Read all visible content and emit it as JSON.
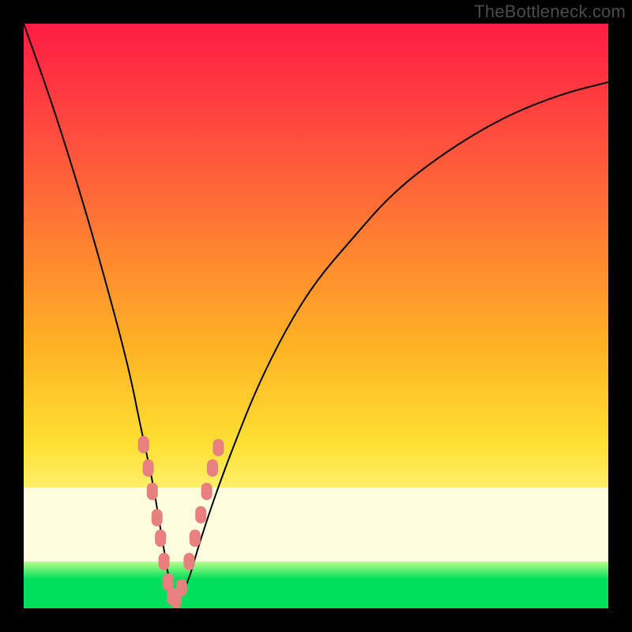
{
  "watermark": "TheBottleneck.com",
  "colors": {
    "frame": "#000000",
    "grad_top": "#ff1c44",
    "grad_mid": "#ffb224",
    "grad_yellow": "#fff06a",
    "grad_pale": "#ffffe0",
    "grad_green": "#00e05c",
    "curve": "#000000",
    "marker_fill": "#e98080",
    "marker_stroke": "#e98080"
  },
  "chart_data": {
    "type": "line",
    "title": "",
    "xlabel": "",
    "ylabel": "",
    "xlim": [
      0,
      100
    ],
    "ylim": [
      0,
      100
    ],
    "grid": false,
    "legend": false,
    "series": [
      {
        "name": "bottleneck-curve",
        "x": [
          0,
          5,
          10,
          14,
          18,
          20,
          22,
          23,
          24,
          25,
          26,
          28,
          30,
          33,
          36,
          40,
          45,
          50,
          56,
          63,
          72,
          82,
          92,
          100
        ],
        "y": [
          100,
          86,
          70,
          56,
          41,
          31,
          22,
          16,
          10,
          4,
          1,
          4,
          11,
          20,
          28,
          38,
          48,
          56,
          63,
          71,
          78,
          84,
          88,
          90
        ]
      }
    ],
    "markers": {
      "name": "highlight-points",
      "x": [
        20.5,
        21.3,
        22.0,
        22.8,
        23.4,
        24.0,
        24.7,
        25.4,
        26.1,
        27.0,
        28.3,
        29.3,
        30.3,
        31.3,
        32.3,
        33.3
      ],
      "y": [
        28.0,
        24.0,
        20.0,
        15.5,
        12.0,
        8.0,
        4.5,
        2.0,
        1.5,
        3.5,
        8.0,
        12.0,
        16.0,
        20.0,
        24.0,
        27.5
      ]
    },
    "notes": "Values are approximate readings from an unlabeled bottleneck chart: x ≈ relative component strength (arbitrary 0–100), y ≈ bottleneck percentage (0 = balanced, 100 = fully bottlenecked). Background hue encodes y (green low, red high)."
  }
}
